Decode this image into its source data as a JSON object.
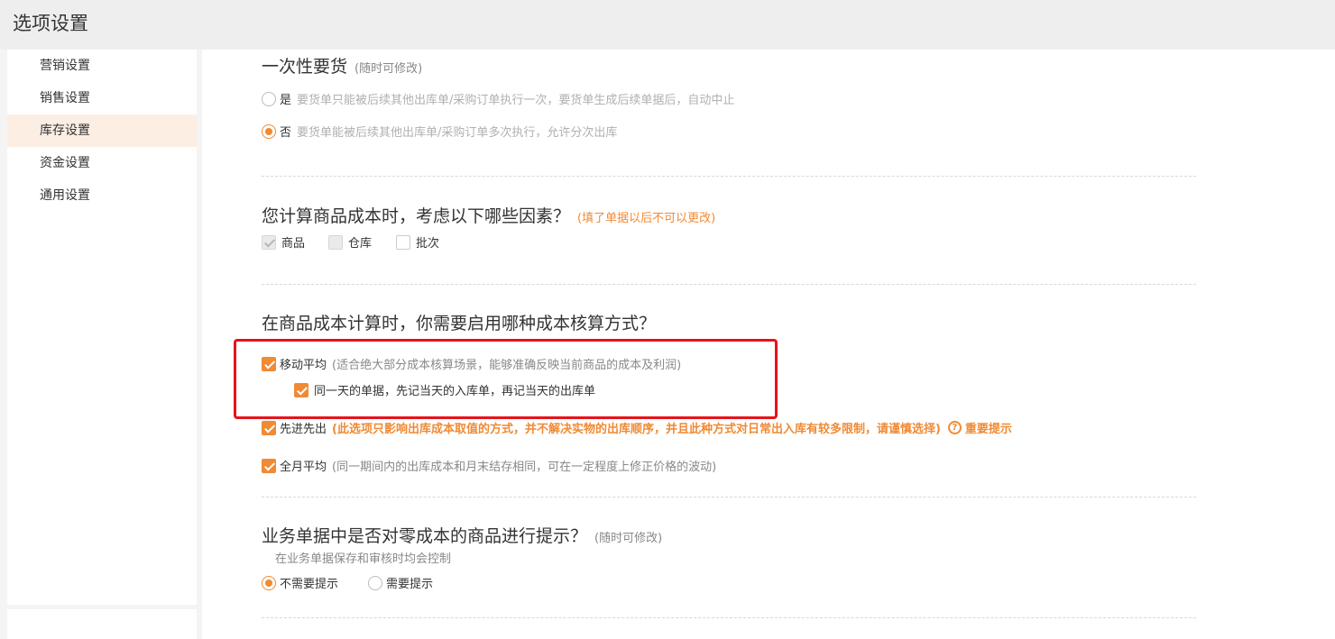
{
  "window": {
    "title": "选项设置"
  },
  "sidebar": {
    "items": [
      {
        "label": "营销设置"
      },
      {
        "label": "销售设置"
      },
      {
        "label": "库存设置"
      },
      {
        "label": "资金设置"
      },
      {
        "label": "通用设置"
      }
    ],
    "active_index": 2
  },
  "sections": {
    "one_time": {
      "title": "一次性要货",
      "note": "(随时可修改)",
      "options": [
        {
          "label": "是",
          "desc": "要货单只能被后续其他出库单/采购订单执行一次，要货单生成后续单据后，自动中止",
          "selected": false
        },
        {
          "label": "否",
          "desc": "要货单能被后续其他出库单/采购订单多次执行，允许分次出库",
          "selected": true
        }
      ]
    },
    "cost_factors": {
      "title": "您计算商品成本时，考虑以下哪些因素？",
      "note": "(填了单据以后不可以更改)",
      "options": [
        {
          "label": "商品",
          "checked": true,
          "disabled": true
        },
        {
          "label": "仓库",
          "checked": false,
          "disabled": true
        },
        {
          "label": "批次",
          "checked": false,
          "disabled": false
        }
      ]
    },
    "cost_method": {
      "title": "在商品成本计算时，你需要启用哪种成本核算方式？",
      "moving_avg": {
        "label": "移动平均",
        "desc": "(适合绝大部分成本核算场景，能够准确反映当前商品的成本及利润)",
        "checked": true
      },
      "same_day": {
        "label": "同一天的单据，先记当天的入库单，再记当天的出库单",
        "checked": true
      },
      "fifo": {
        "label": "先进先出",
        "desc": "(此选项只影响出库成本取值的方式，并不解决实物的出库顺序，并且此种方式对日常出入库有较多限制，请谨慎选择)",
        "checked": true,
        "hint": "重要提示"
      },
      "monthly_avg": {
        "label": "全月平均",
        "desc": "(同一期间内的出库成本和月末结存相同，可在一定程度上修正价格的波动)",
        "checked": true
      }
    },
    "zero_cost": {
      "title": "业务单据中是否对零成本的商品进行提示？",
      "note": "(随时可修改)",
      "sub_note": "在业务单据保存和审核时均会控制",
      "options": [
        {
          "label": "不需要提示",
          "selected": true
        },
        {
          "label": "需要提示",
          "selected": false
        }
      ]
    }
  },
  "colors": {
    "accent": "#f08a34",
    "highlight": "#e8121a",
    "active_bg": "#fdeee4"
  }
}
